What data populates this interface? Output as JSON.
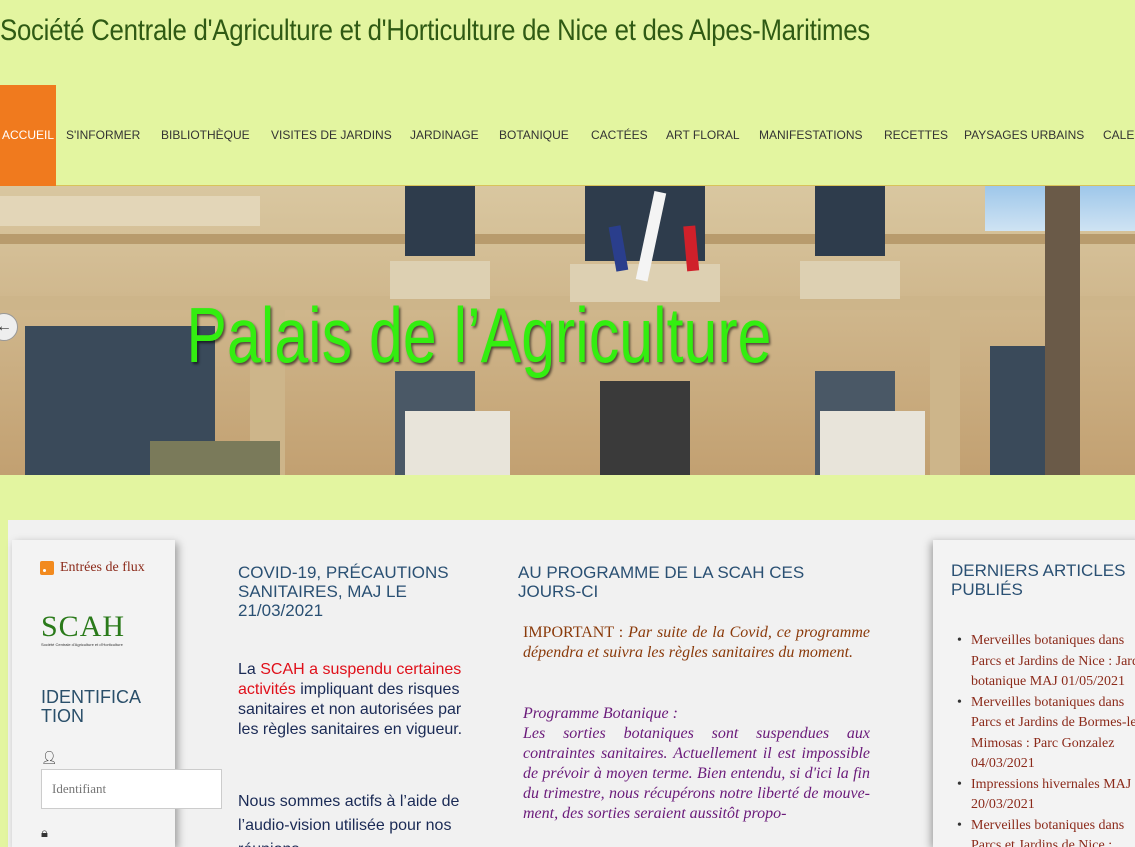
{
  "site_title": "Société Centrale d'Agriculture et d'Horticulture de Nice et des Alpes-Maritimes",
  "nav": {
    "items": [
      "Accueil",
      "S'informer",
      "Bibliothèque",
      "Visites de jardins",
      "Jardinage",
      "Botanique",
      "Cactées",
      "Art floral",
      "Manifestations",
      "Recettes",
      "Paysages urbains",
      "Calen"
    ]
  },
  "hero": {
    "title": "Palais de l’Agriculture"
  },
  "sidebar": {
    "rss_label": "Entrées de flux",
    "logo_text": "SCAH",
    "logo_subtitle": "Société Centrale d'Agriculture et d'Horticulture",
    "login_title": "IDENTIFICATION",
    "username_placeholder": "Identifiant"
  },
  "covid": {
    "title": "COVID-19, PRÉCAUTIONS SANITAIRES, MAJ LE 21/03/2021",
    "p1_prefix": "La ",
    "p1_red": "SCAH a suspendu certaines activités",
    "p1_rest": " impliquant des risques sanitaires et non autorisées par les règles sanitaires en vigueur.",
    "p2": "Nous sommes actifs à l’aide de l’audio-vision utilisée pour nos réunions"
  },
  "programme": {
    "title": "AU PROGRAMME DE LA SCAH CES JOURS-CI",
    "important_label": "IMPORTANT : ",
    "important_text": "Par suite de la Covid, ce programme dépendra et suivra les règles sanitaires du moment.",
    "bota_heading": "Programme Botanique :",
    "bota_text": "Les sorties botaniques sont suspendues aux contraintes sanitaires. Actuellement il est impossible de prévoir à moyen terme. Bien entendu, si d'ici la fin du trimestre, nous récupérons notre liberté de mouve-ment, des sorties seraient aussitôt propo-"
  },
  "recent": {
    "title": "DERNIERS ARTICLES PUBLIÉS",
    "lines": [
      {
        "text": "Merveilles botaniques dans",
        "bullet": true
      },
      {
        "text": "Parcs et Jardins de Nice : Jardin",
        "bullet": false
      },
      {
        "text": "botanique MAJ 01/05/2021",
        "bullet": false
      },
      {
        "text": "Merveilles botaniques dans",
        "bullet": true
      },
      {
        "text": "Parcs et Jardins de Bormes-les-",
        "bullet": false
      },
      {
        "text": "Mimosas : Parc Gonzalez",
        "bullet": false
      },
      {
        "text": "04/03/2021",
        "bullet": false
      },
      {
        "text": "Impressions hivernales MAJ",
        "bullet": true
      },
      {
        "text": "20/03/2021",
        "bullet": false
      },
      {
        "text": "Merveilles botaniques dans",
        "bullet": true
      },
      {
        "text": "Parcs et Jardins de Nice :",
        "bullet": false
      }
    ]
  }
}
